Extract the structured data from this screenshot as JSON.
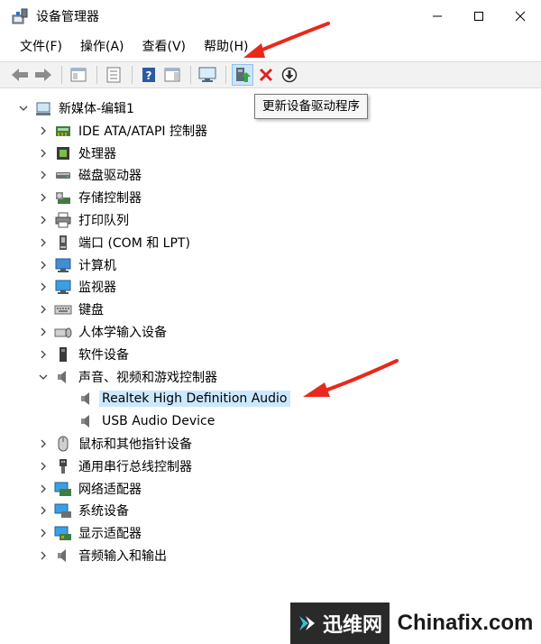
{
  "window": {
    "title": "设备管理器"
  },
  "menu": [
    {
      "label": "文件(F)"
    },
    {
      "label": "操作(A)"
    },
    {
      "label": "查看(V)"
    },
    {
      "label": "帮助(H)"
    }
  ],
  "toolbar": {
    "buttons": [
      {
        "icon": "back-arrow-icon"
      },
      {
        "icon": "forward-arrow-icon"
      },
      {
        "icon": "show-hide-tree-icon"
      },
      {
        "icon": "properties-icon"
      },
      {
        "icon": "help-icon"
      },
      {
        "icon": "action-pane-icon"
      },
      {
        "icon": "monitor-icon"
      },
      {
        "icon": "update-driver-icon"
      },
      {
        "icon": "uninstall-icon"
      },
      {
        "icon": "download-icon"
      }
    ],
    "tooltip": "更新设备驱动程序"
  },
  "tree": {
    "root": "新媒体-编辑1",
    "items": [
      {
        "label": "IDE ATA/ATAPI 控制器",
        "icon": "ide-controller-icon",
        "expanded": false
      },
      {
        "label": "处理器",
        "icon": "processor-icon",
        "expanded": false
      },
      {
        "label": "磁盘驱动器",
        "icon": "disk-drive-icon",
        "expanded": false
      },
      {
        "label": "存储控制器",
        "icon": "storage-controller-icon",
        "expanded": false
      },
      {
        "label": "打印队列",
        "icon": "printer-icon",
        "expanded": false
      },
      {
        "label": "端口 (COM 和 LPT)",
        "icon": "port-icon",
        "expanded": false
      },
      {
        "label": "计算机",
        "icon": "computer-icon",
        "expanded": false
      },
      {
        "label": "监视器",
        "icon": "monitor-icon",
        "expanded": false
      },
      {
        "label": "键盘",
        "icon": "keyboard-icon",
        "expanded": false
      },
      {
        "label": "人体学输入设备",
        "icon": "hid-icon",
        "expanded": false
      },
      {
        "label": "软件设备",
        "icon": "software-device-icon",
        "expanded": false
      },
      {
        "label": "声音、视频和游戏控制器",
        "icon": "speaker-icon",
        "expanded": true,
        "children": [
          {
            "label": "Realtek High Definition Audio",
            "icon": "speaker-icon",
            "selected": true
          },
          {
            "label": "USB Audio Device",
            "icon": "speaker-icon",
            "selected": false
          }
        ]
      },
      {
        "label": "鼠标和其他指针设备",
        "icon": "mouse-icon",
        "expanded": false
      },
      {
        "label": "通用串行总线控制器",
        "icon": "usb-icon",
        "expanded": false
      },
      {
        "label": "网络适配器",
        "icon": "network-adapter-icon",
        "expanded": false
      },
      {
        "label": "系统设备",
        "icon": "system-device-icon",
        "expanded": false
      },
      {
        "label": "显示适配器",
        "icon": "display-adapter-icon",
        "expanded": false
      },
      {
        "label": "音频输入和输出",
        "icon": "audio-io-icon",
        "expanded": false
      }
    ]
  },
  "watermark": {
    "left": "迅维网",
    "right": "Chinafix.com"
  },
  "colors": {
    "arrow": "#e8291c",
    "selection": "#cce8ff",
    "toolbar_bg": "#f2f2f2"
  }
}
